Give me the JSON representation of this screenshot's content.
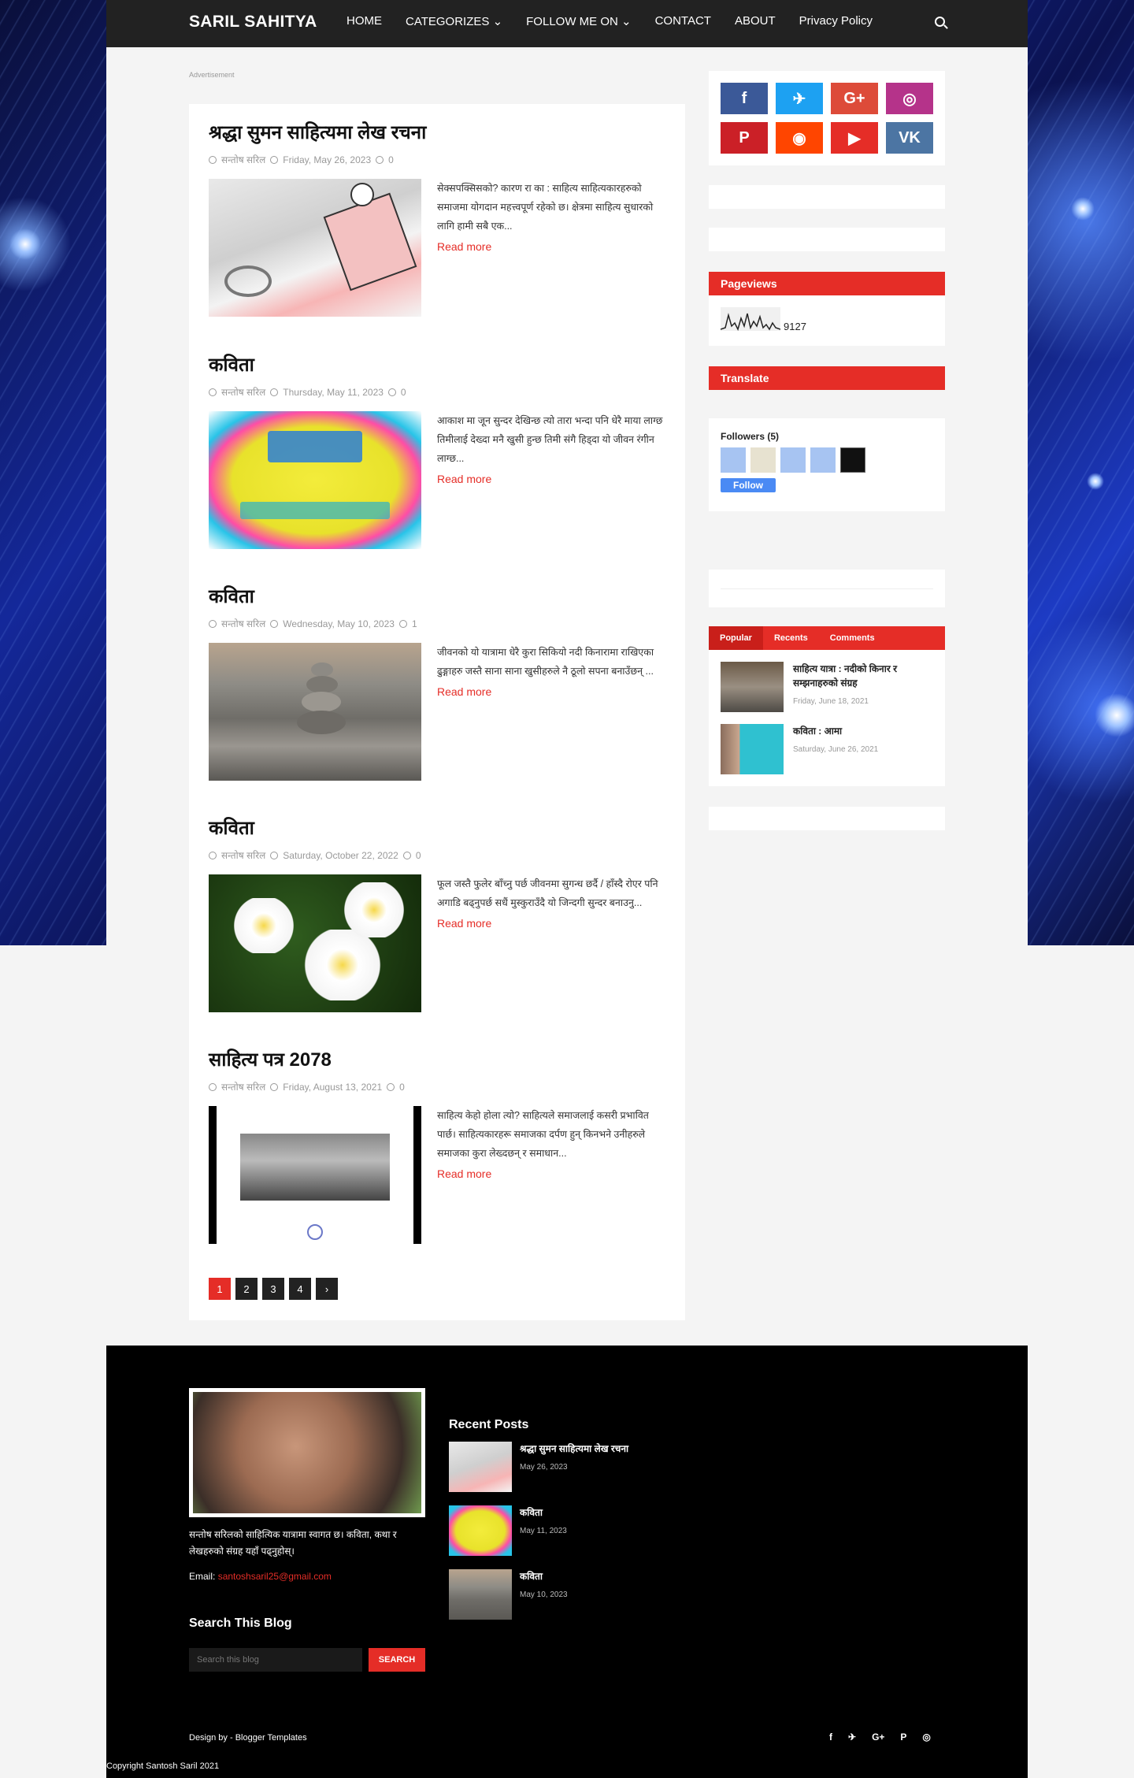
{
  "site": {
    "title": "SARIL SAHITYA"
  },
  "nav": {
    "items": [
      "HOME",
      "CATEGORIZES ⌄",
      "FOLLOW ME ON ⌄",
      "CONTACT",
      "ABOUT",
      "Privacy Policy"
    ]
  },
  "ad_label": "Advertisement",
  "posts": [
    {
      "title": "श्रद्धा सुमन साहित्यमा लेख रचना",
      "author": "सन्तोष सरिल",
      "date": "Friday, May 26, 2023",
      "comments": "0",
      "excerpt": "सेक्सपक्सिसको? कारण रा का : साहित्य साहित्यकारहरुको समाजमा योगदान महत्त्वपूर्ण रहेको छ। क्षेत्रमा साहित्य सुधारको लागि हामी सबै एक...",
      "readmore": "Read more"
    },
    {
      "title": "कविता",
      "author": "सन्तोष सरिल",
      "date": "Thursday, May 11, 2023",
      "comments": "0",
      "excerpt": "आकाश मा जून सुन्दर देखिन्छ त्यो तारा भन्दा पनि धेरै माया लाग्छ तिमीलाई देख्दा मनै खुसी हुन्छ तिमी संगै हिड्दा यो जीवन रंगीन लाग्छ...",
      "readmore": "Read more"
    },
    {
      "title": "कविता",
      "author": "सन्तोष सरिल",
      "date": "Wednesday, May 10, 2023",
      "comments": "1",
      "excerpt": "जीवनको यो यात्रामा धेरै कुरा सिकियो नदी किनारामा राखिएका ढुङ्गाहरु जस्तै साना साना खुसीहरुले नै ठूलो सपना बनाउँछन् ...",
      "readmore": "Read more"
    },
    {
      "title": "कविता",
      "author": "सन्तोष सरिल",
      "date": "Saturday, October 22, 2022",
      "comments": "0",
      "excerpt": "फूल जस्तै फुलेर बाँच्नु पर्छ जीवनमा सुगन्ध छर्दै / हाँस्दै रोएर पनि अगाडि बढ्नुपर्छ सधैं मुस्कुराउँदै यो जिन्दगी सुन्दर बनाउनु...",
      "readmore": "Read more"
    },
    {
      "title": "साहित्य पत्र 2078",
      "author": "सन्तोष सरिल",
      "date": "Friday, August 13, 2021",
      "comments": "0",
      "excerpt": "साहित्य केहो होला त्यो? साहित्यले समाजलाई कसरी प्रभावित पार्छ। साहित्यकारहरू समाजका दर्पण हुन् किनभने उनीहरुले समाजका कुरा लेख्दछन् र समाधान...",
      "readmore": "Read more"
    }
  ],
  "pagination": [
    "1",
    "2",
    "3",
    "4",
    "›"
  ],
  "sidebar": {
    "social": [
      {
        "icon": "facebook-icon",
        "glyph": "f",
        "color": "#3b5998"
      },
      {
        "icon": "twitter-icon",
        "glyph": "✈",
        "color": "#1da1f2"
      },
      {
        "icon": "google-plus-icon",
        "glyph": "G+",
        "color": "#dd4b39"
      },
      {
        "icon": "instagram-icon",
        "glyph": "◎",
        "color": "#b5338a"
      },
      {
        "icon": "pinterest-icon",
        "glyph": "P",
        "color": "#cb2027"
      },
      {
        "icon": "reddit-icon",
        "glyph": "◉",
        "color": "#ff4500"
      },
      {
        "icon": "youtube-icon",
        "glyph": "▶",
        "color": "#e52d27"
      },
      {
        "icon": "vk-icon",
        "glyph": "VK",
        "color": "#4c75a3"
      }
    ],
    "pageviews_title": "Pageviews",
    "pageviews_count": "9127",
    "translate_title": "Translate",
    "followers_title": "Followers (5)",
    "follow_label": "Follow",
    "tabs": [
      "Popular",
      "Recents",
      "Comments"
    ],
    "popular": [
      {
        "title": "साहित्य यात्रा : नदीको किनार र सम्झनाहरुको संग्रह",
        "date": "Friday, June 18, 2021"
      },
      {
        "title": "कविता : आमा",
        "date": "Saturday, June 26, 2021"
      }
    ]
  },
  "footer": {
    "bio": "सन्तोष सरिलको साहित्यिक यात्रामा स्वागत छ। कविता, कथा र लेखहरुको संग्रह यहाँ पढ्नुहोस्।",
    "email_label": "Email:",
    "email": "santoshsaril25@gmail.com",
    "search_title": "Search This Blog",
    "search_placeholder": "Search this blog",
    "search_button": "SEARCH",
    "recent_title": "Recent Posts",
    "recent": [
      {
        "title": "श्रद्धा सुमन साहित्यमा लेख रचना",
        "date": "May 26, 2023"
      },
      {
        "title": "कविता",
        "date": "May 11, 2023"
      },
      {
        "title": "कविता",
        "date": "May 10, 2023"
      }
    ],
    "credit": "Design by - Blogger Templates",
    "copyright": "Copyright Santosh Saril 2021"
  }
}
